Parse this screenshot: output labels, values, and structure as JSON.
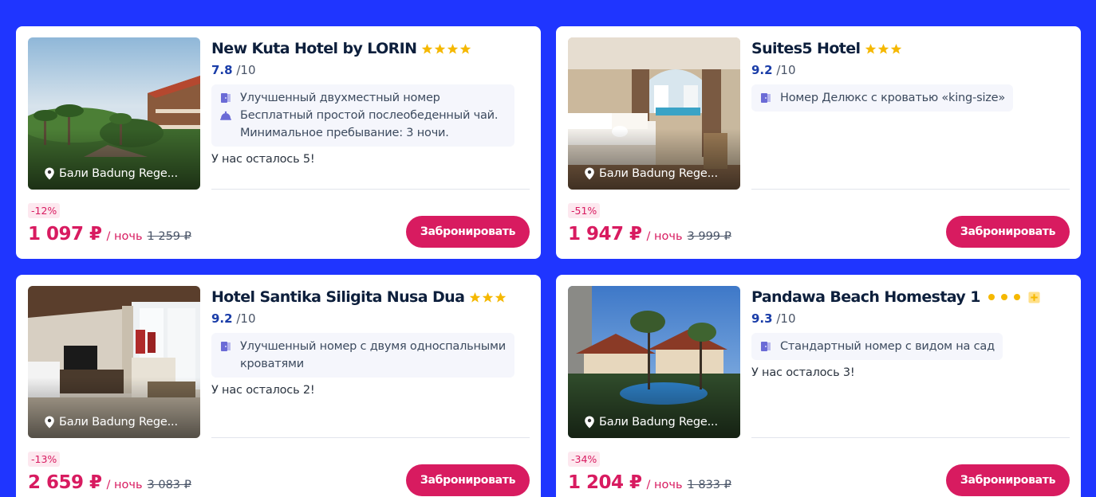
{
  "colors": {
    "background": "#1f35ff",
    "accent": "#d81b60",
    "rating": "#1a3da8",
    "star": "#f5b800",
    "feature_icon": "#6b6bd6"
  },
  "hotels": [
    {
      "name": "New Kuta Hotel by LORIN",
      "stars": 4,
      "star_style": "star",
      "score": "7.8",
      "score_max": "/10",
      "location": "Бали Badung Rege...",
      "features": [
        {
          "icon": "door-icon",
          "text": "Улучшенный двухместный номер"
        },
        {
          "icon": "cloche-icon",
          "text": "Бесплатный простой послеобеденный чай. Минимальное пребывание: 3 ночи."
        }
      ],
      "left_note": "У нас осталось 5!",
      "discount": "-12%",
      "price": "1 097 ₽",
      "per_night": "/ ночь",
      "old_price": "1 259 ₽",
      "button": "Забронировать",
      "photo": "resort-garden"
    },
    {
      "name": "Suites5 Hotel",
      "stars": 3,
      "star_style": "star",
      "score": "9.2",
      "score_max": "/10",
      "location": "Бали Badung Rege...",
      "features": [
        {
          "icon": "door-icon",
          "text": "Номер Делюкс с кроватью «king-size»"
        }
      ],
      "left_note": "",
      "discount": "-51%",
      "price": "1 947 ₽",
      "per_night": "/ ночь",
      "old_price": "3 999 ₽",
      "button": "Забронировать",
      "photo": "bedroom-pool-view"
    },
    {
      "name": "Hotel Santika Siligita Nusa Dua",
      "stars": 3,
      "star_style": "star",
      "score": "9.2",
      "score_max": "/10",
      "location": "Бали Badung Rege...",
      "features": [
        {
          "icon": "door-icon",
          "text": "Улучшенный номер с двумя односпальными кроватями"
        }
      ],
      "left_note": "У нас осталось 2!",
      "discount": "-13%",
      "price": "2 659 ₽",
      "per_night": "/ ночь",
      "old_price": "3 083 ₽",
      "button": "Забронировать",
      "photo": "hotel-room-tv"
    },
    {
      "name": "Pandawa Beach Homestay 1",
      "stars": 3,
      "star_style": "dot",
      "score": "9.3",
      "score_max": "/10",
      "location": "Бали Badung Rege...",
      "features": [
        {
          "icon": "door-icon",
          "text": "Стандартный номер с видом на сад"
        }
      ],
      "left_note": "У нас осталось 3!",
      "discount": "-34%",
      "price": "1 204 ₽",
      "per_night": "/ ночь",
      "old_price": "1 833 ₽",
      "button": "Забронировать",
      "photo": "pool-villas"
    }
  ]
}
